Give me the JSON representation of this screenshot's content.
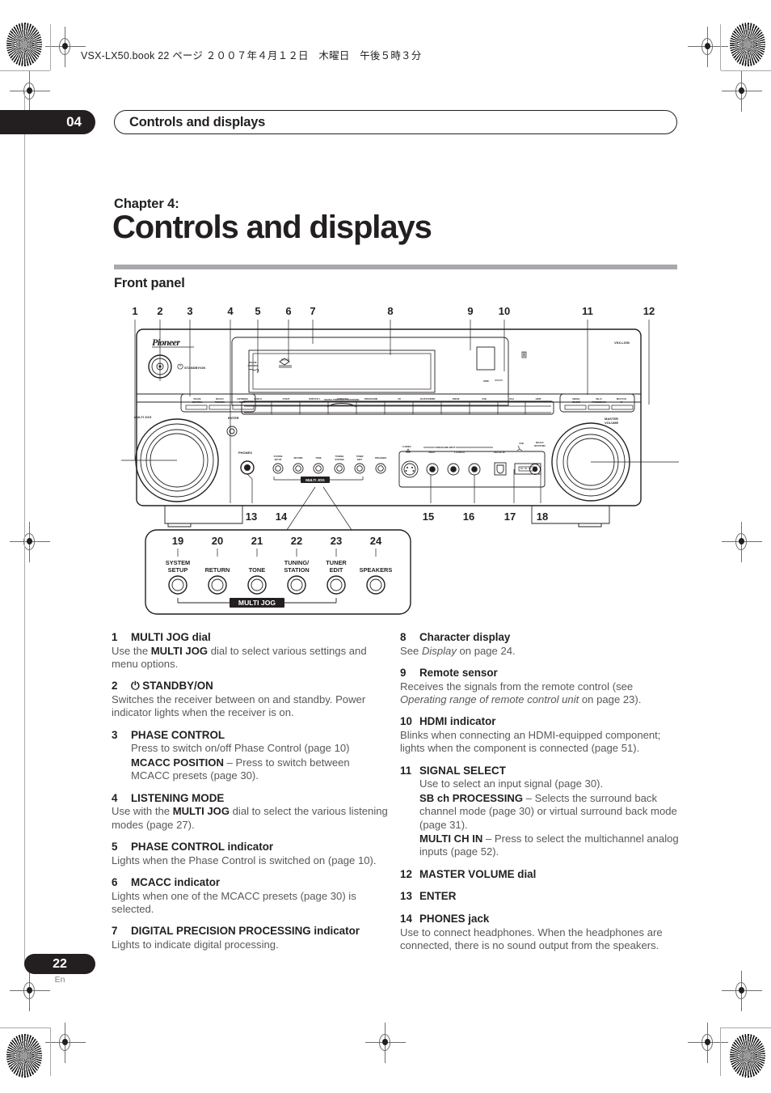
{
  "print_header": {
    "text": "VSX-LX50.book  22 ページ  ２００７年４月１２日　木曜日　午後５時３分"
  },
  "chapter_bar": {
    "number": "04",
    "title": "Controls and displays"
  },
  "chapter": {
    "label": "Chapter 4:",
    "title": "Controls and displays"
  },
  "section": {
    "title": "Front panel"
  },
  "figure": {
    "brand": "Pioneer",
    "model": "VSX-LX50",
    "standby_label": "STANDBY/ON",
    "phase_control_indicator": "PHASE\nCONTROL",
    "display_caption": "DIGITAL PRECISION PROCESSING",
    "hdmi_indicator": "HDMI",
    "multi_jog_label": "MULTI JOG",
    "enter_label": "ENTER",
    "master_volume_label": "MASTER\nVOLUME",
    "phones_label": "PHONES",
    "multi_jog_bracket": "MULTI JOG",
    "left_buttons": [
      "PHASE\nCONTROL",
      "MCACC\nPOSITION",
      "LISTENING\nMODE"
    ],
    "right_buttons": [
      "SIGNAL\nSELECT",
      "SB ch\nPROCESSING",
      "MULTI CH\nIN"
    ],
    "input_selectors": [
      "DVD/LD",
      "TV/SAT",
      "DVR/VCR 1",
      "DVR/VCR 2",
      "VIDEO/GAME",
      "CD",
      "CD-R/TAPE/MD",
      "FM/AM",
      "USB",
      "iPod",
      "HDMI"
    ],
    "small_buttons": [
      "SYSTEM\nSETUP",
      "RETURN",
      "TONE",
      "TUNING/\nSTATION",
      "TUNER\nEDIT",
      "SPEAKERS"
    ],
    "jack_labels": {
      "s_video": "S-VIDEO",
      "group": "VIDEO/GAME INPUT",
      "video": "VIDEO",
      "audio": "L  AUDIO  R",
      "digital_in": "DIGITAL IN",
      "usb": "USB",
      "mcacc_mic": "MCACC\nSETUP MIC"
    },
    "callouts_top": [
      "1",
      "2",
      "3",
      "4",
      "5",
      "6",
      "7",
      "8",
      "9",
      "10",
      "11",
      "12"
    ],
    "callouts_mid": [
      "13",
      "14",
      "15",
      "16",
      "17",
      "18"
    ],
    "callouts_bottom": [
      "19",
      "20",
      "21",
      "22",
      "23",
      "24"
    ],
    "detail_buttons": [
      {
        "num": "19",
        "label": "SYSTEM\nSETUP"
      },
      {
        "num": "20",
        "label": "RETURN"
      },
      {
        "num": "21",
        "label": "TONE"
      },
      {
        "num": "22",
        "label": "TUNING/\nSTATION"
      },
      {
        "num": "23",
        "label": "TUNER\nEDIT"
      },
      {
        "num": "24",
        "label": "SPEAKERS"
      }
    ]
  },
  "items_left": [
    {
      "num": "1",
      "title": "MULTI JOG dial",
      "desc_html": "Use the <b>MULTI JOG</b> dial to select various settings and menu options."
    },
    {
      "num": "2",
      "title": "⏻ STANDBY/ON",
      "desc_html": "Switches the receiver between on and standby. Power indicator lights when the receiver is on."
    },
    {
      "num": "3",
      "title": "PHASE CONTROL",
      "desc_html": "Press to switch on/off Phase Control (page 10)",
      "sub_html": "<b>MCACC POSITION</b> &ndash; Press to switch between MCACC presets  (page 30).",
      "indent": true
    },
    {
      "num": "4",
      "title": "LISTENING MODE",
      "desc_html": "Use with the <b>MULTI JOG</b> dial to select the various listening modes (page 27)."
    },
    {
      "num": "5",
      "title": "PHASE CONTROL indicator",
      "desc_html": "Lights when the Phase Control is switched on (page 10)."
    },
    {
      "num": "6",
      "title": "MCACC indicator",
      "desc_html": "Lights when one of the MCACC presets (page 30) is selected."
    },
    {
      "num": "7",
      "title": "DIGITAL PRECISION PROCESSING indicator",
      "desc_html": "Lights to indicate digital processing."
    }
  ],
  "items_right": [
    {
      "num": "8",
      "title": "Character display",
      "desc_html": "See <i>Display</i> on page 24."
    },
    {
      "num": "9",
      "title": "Remote sensor",
      "desc_html": "Receives the signals from the remote control (see <i>Operating range of remote control unit</i> on page 23)."
    },
    {
      "num": "10",
      "title": "HDMI indicator",
      "desc_html": "Blinks when connecting an HDMI-equipped component; lights when the component is connected (page 51)."
    },
    {
      "num": "11",
      "title": "SIGNAL SELECT",
      "desc_html": "Use to select an input signal (page 30).",
      "indent": true,
      "sub_html": "<b>SB ch PROCESSING</b> &ndash; Selects the surround back channel mode (page 30) or virtual surround back mode (page 31).",
      "sub2_html": "<b>MULTI CH IN</b> &ndash; Press to select the multichannel analog inputs (page 52)."
    },
    {
      "num": "12",
      "title": "MASTER VOLUME dial",
      "desc_html": ""
    },
    {
      "num": "13",
      "title": "ENTER",
      "desc_html": ""
    },
    {
      "num": "14",
      "title": "PHONES jack",
      "desc_html": "Use to connect headphones. When the headphones are connected, there is no sound output from the speakers."
    }
  ],
  "footer": {
    "page_number": "22",
    "language": "En"
  },
  "colors": {
    "ink": "#231f20",
    "body_text": "#58595b",
    "rule": "#a7a9ac"
  }
}
